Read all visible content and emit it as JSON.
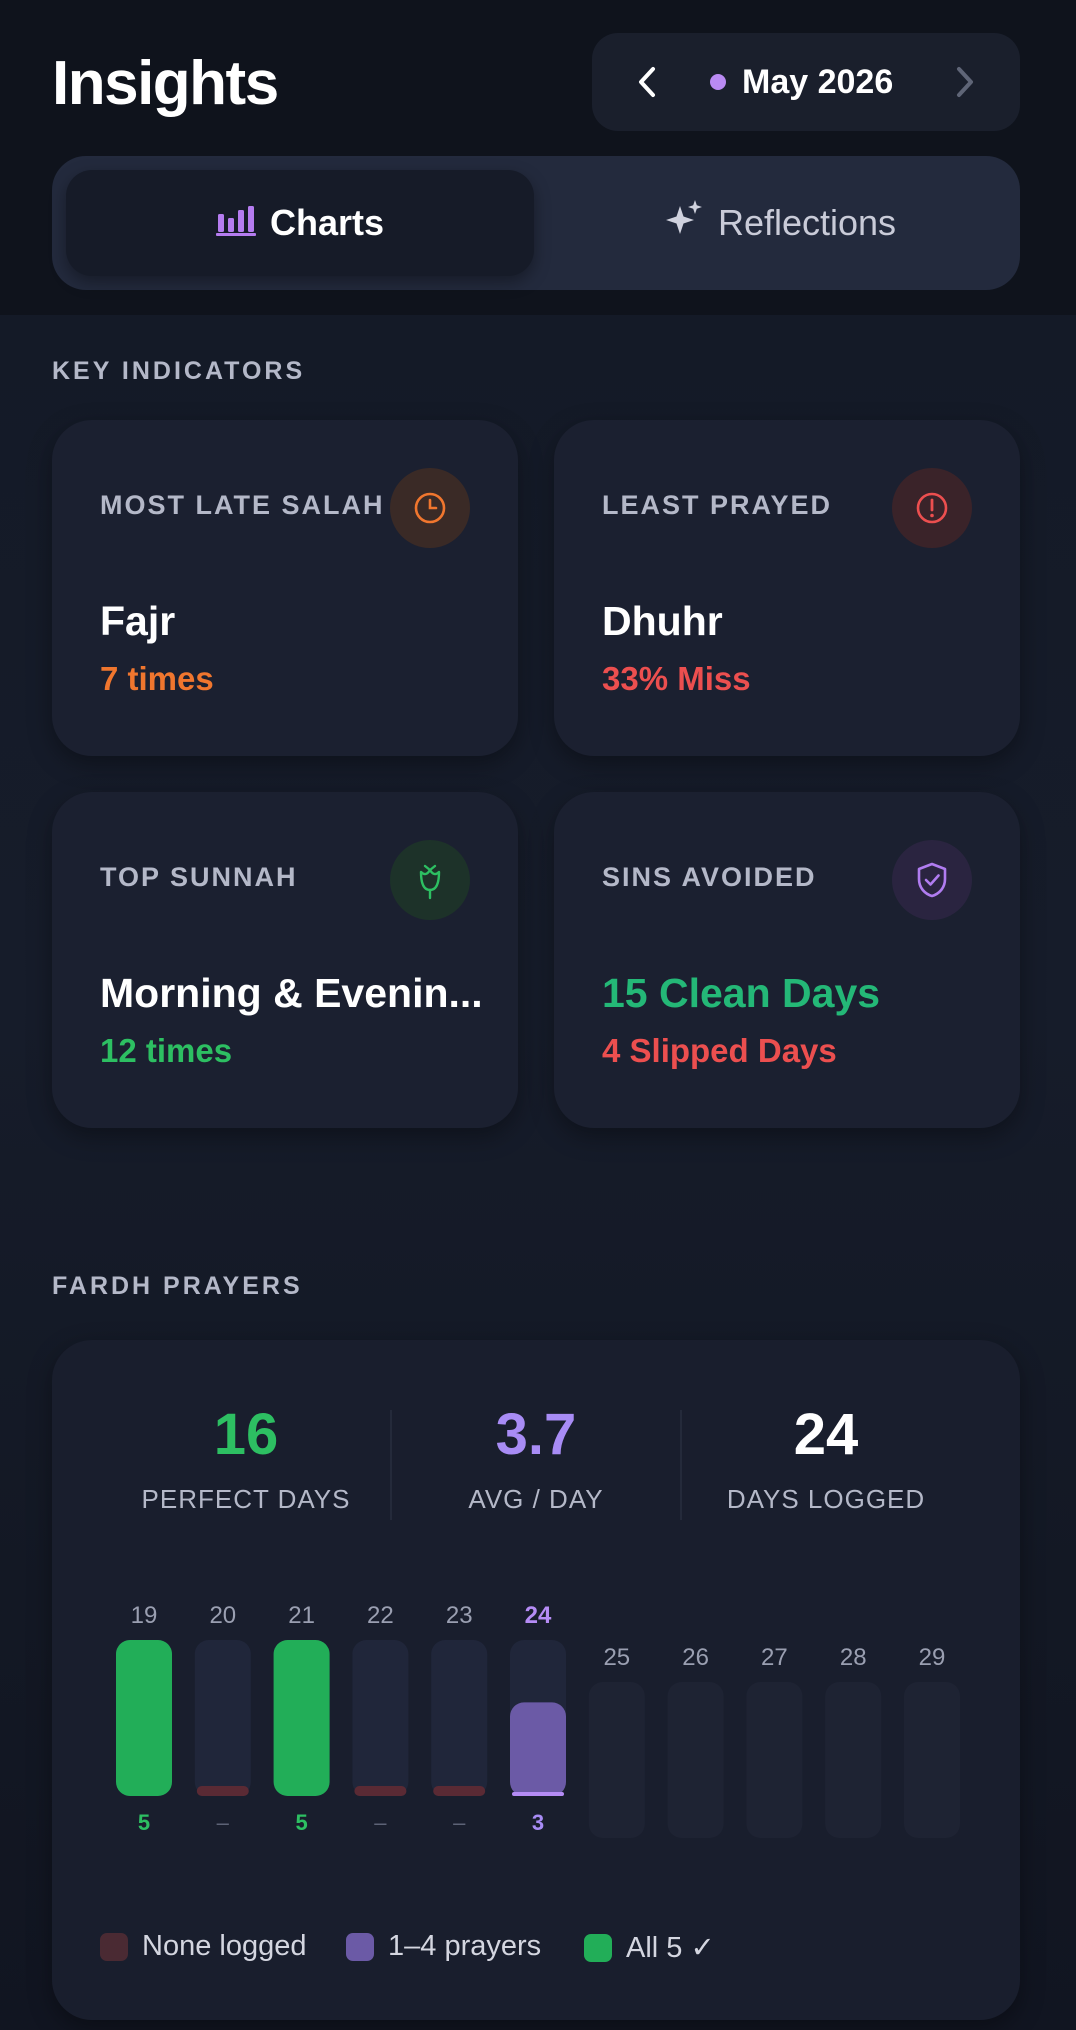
{
  "header": {
    "title": "Insights",
    "month": "May 2026",
    "prev_icon": "chevron-left-icon",
    "next_icon": "chevron-right-icon"
  },
  "tabs": [
    {
      "label": "Charts",
      "icon": "bar-chart-icon",
      "active": true
    },
    {
      "label": "Reflections",
      "icon": "sparkles-icon",
      "active": false
    }
  ],
  "key_indicators": {
    "section_label": "KEY INDICATORS",
    "cards": [
      {
        "label": "MOST LATE SALAH",
        "icon": "clock-icon",
        "value": "Fajr",
        "sub": "7 times",
        "value_color": "#ffffff",
        "sub_color": "#f0762e"
      },
      {
        "label": "LEAST PRAYED",
        "icon": "alert-icon",
        "value": "Dhuhr",
        "sub": "33% Miss",
        "value_color": "#ffffff",
        "sub_color": "#ec4f4f"
      },
      {
        "label": "TOP SUNNAH",
        "icon": "rose-icon",
        "value": "Morning & Evenin...",
        "sub": "12 times",
        "value_color": "#ffffff",
        "sub_color": "#2dbf62"
      },
      {
        "label": "SINS AVOIDED",
        "icon": "shield-check-icon",
        "value": "15 Clean Days",
        "sub": "4 Slipped Days",
        "value_color": "#24b877",
        "sub_color": "#ec4f4f"
      }
    ]
  },
  "fardh": {
    "section_label": "FARDH PRAYERS",
    "stats": [
      {
        "value": "16",
        "label": "PERFECT DAYS",
        "color": "#2dbf62"
      },
      {
        "value": "3.7",
        "label": "AVG / DAY",
        "color": "#a88cf5"
      },
      {
        "value": "24",
        "label": "DAYS LOGGED",
        "color": "#ffffff"
      }
    ],
    "legend": [
      {
        "label": "None logged",
        "color": "#4a2a33"
      },
      {
        "label": "1–4 prayers",
        "color": "#6b5aa6"
      },
      {
        "label": "All 5 ✓",
        "color": "#22ae58"
      }
    ]
  },
  "chart_data": {
    "type": "bar",
    "categories": [
      "19",
      "20",
      "21",
      "22",
      "23",
      "24",
      "25",
      "26",
      "27",
      "28",
      "29"
    ],
    "values": [
      5,
      0,
      5,
      0,
      0,
      3,
      null,
      null,
      null,
      null,
      null
    ],
    "value_labels": [
      "5",
      "–",
      "5",
      "–",
      "–",
      "3",
      "",
      "",
      "",
      "",
      ""
    ],
    "ylim": [
      0,
      5
    ],
    "selected": "24",
    "future_categories": [
      "25",
      "26",
      "27",
      "28",
      "29"
    ]
  }
}
